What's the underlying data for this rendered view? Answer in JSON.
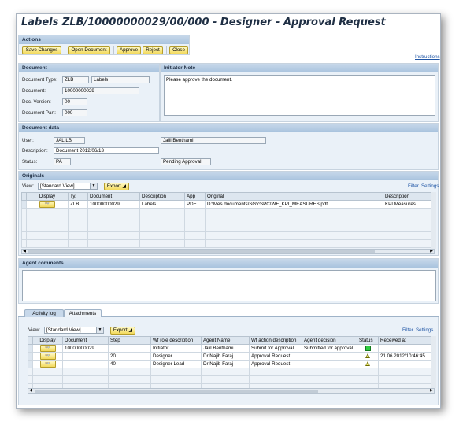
{
  "window": {
    "title": "Labels ZLB/10000000029/00/000 - Designer - Approval Request"
  },
  "actions": {
    "header": "Actions",
    "buttons": [
      "Save Changes",
      "Open Document",
      "Approve",
      "Reject",
      "Close"
    ]
  },
  "instructions_link": "Instructions",
  "document": {
    "header": "Document",
    "type_label": "Document Type:",
    "type_value": "ZLB",
    "type_desc": "Labels",
    "doc_label": "Document:",
    "doc_value": "10000000029",
    "version_label": "Doc. Version:",
    "version_value": "00",
    "part_label": "Document Part:",
    "part_value": "000"
  },
  "initiator_note": {
    "header": "Initiator Note",
    "text": "Please approve the document."
  },
  "document_data": {
    "header": "Document data",
    "user_label": "User:",
    "user_value": "JALILB",
    "user_name": "Jalil Benthami",
    "desc_label": "Description:",
    "desc_value": "Document 2012/06/13",
    "status_label": "Status:",
    "status_value": "PA",
    "status_desc": "Pending Approval"
  },
  "originals": {
    "header": "Originals",
    "view_label": "View:",
    "view_value": "[Standard View]",
    "export_label": "Export ◢",
    "filter_label": "Filter",
    "settings_label": "Settings",
    "columns": [
      "Display",
      "Ty.",
      "Document",
      "Description",
      "App",
      "Original",
      "Description"
    ],
    "rows": [
      [
        "",
        "ZLB",
        "10000000029",
        "Labels",
        "PDF",
        "D:\\Mes documents\\SG\\cSPC\\WF_KPI_MEASURES.pdf",
        "KPI Measures"
      ]
    ]
  },
  "agent_comments": {
    "header": "Agent comments"
  },
  "tabs": {
    "activity": "Activity log",
    "attachments": "Attachments"
  },
  "activity": {
    "view_label": "View:",
    "view_value": "[Standard View]",
    "export_label": "Export ◢",
    "filter_label": "Filter",
    "settings_label": "Settings",
    "columns": [
      "Display",
      "Document",
      "Step",
      "Wf role description",
      "Agent Name",
      "Wf action description",
      "Agent decision",
      "Status",
      "Received at"
    ],
    "rows": [
      [
        "",
        "10000000029",
        "",
        "Initiator",
        "Jalil Benthami",
        "Submit for Approval",
        "Submitted for approval",
        "green",
        ""
      ],
      [
        "",
        "",
        "20",
        "Designer",
        "Dr Najib Faraj",
        "Approval Request",
        "",
        "yellow",
        "21.06.2012/10:46:45"
      ],
      [
        "",
        "",
        "40",
        "Designer Lead",
        "Dr Najib Faraj",
        "Approval Request",
        "",
        "yellow",
        ""
      ]
    ]
  }
}
